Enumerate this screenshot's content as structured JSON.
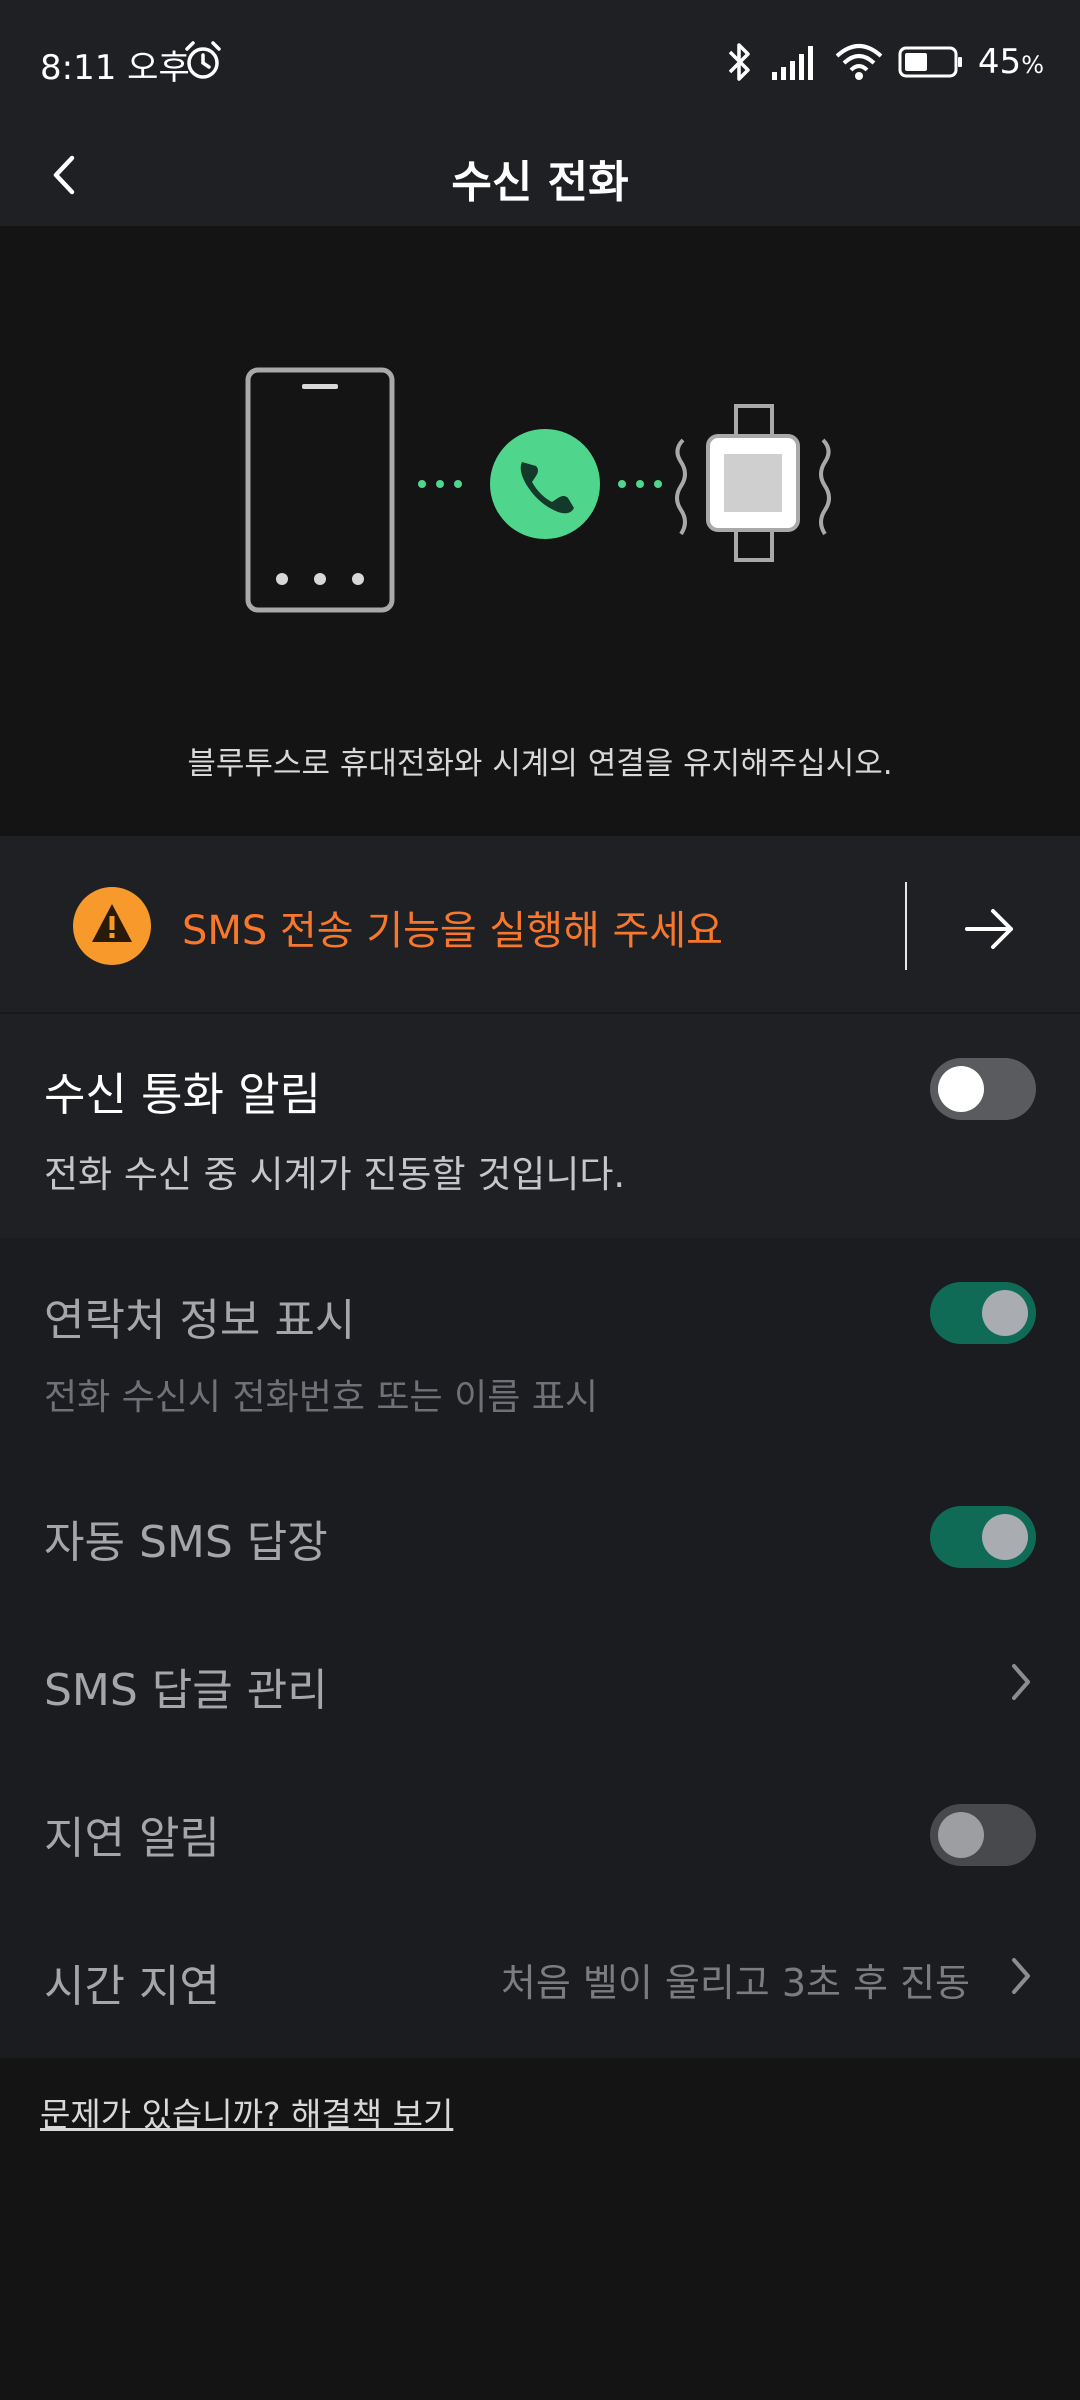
{
  "status_bar": {
    "time": "8:11 오후",
    "battery_percent": "45",
    "battery_unit": "%",
    "icons": [
      "alarm-icon",
      "bluetooth-icon",
      "signal-icon",
      "wifi-icon",
      "battery-icon"
    ]
  },
  "header": {
    "title": "수신 전화",
    "back_icon": "back-chevron-icon"
  },
  "hero": {
    "caption": "블루투스로 휴대전화와 시계의 연결을 유지해주십시오."
  },
  "warning": {
    "text": "SMS 전송 기능을 실행해 주세요",
    "color": "#f7782c",
    "icon_color": "#f79a2b"
  },
  "incoming_call_alert": {
    "title": "수신 통화 알림",
    "description": "전화 수신 중 시계가 진동할 것입니다.",
    "enabled": false
  },
  "settings": [
    {
      "label": "연락처 정보 표시",
      "description": "전화 수신시 전화번호 또는 이름 표시",
      "toggle": true
    },
    {
      "label": "자동 SMS 답장",
      "toggle": true
    },
    {
      "label": "SMS 답글 관리",
      "chevron": true
    },
    {
      "label": "지연 알림",
      "toggle": false
    },
    {
      "label": "시간 지연",
      "value": "처음 벨이 울리고 3초 후 진동",
      "chevron": true
    }
  ],
  "help_link": "문제가 있습니까? 해결책 보기",
  "colors": {
    "accent_green": "#4fd68c",
    "toggle_on": "#0f6b55",
    "background": "#141414",
    "panel": "#1f2023"
  }
}
